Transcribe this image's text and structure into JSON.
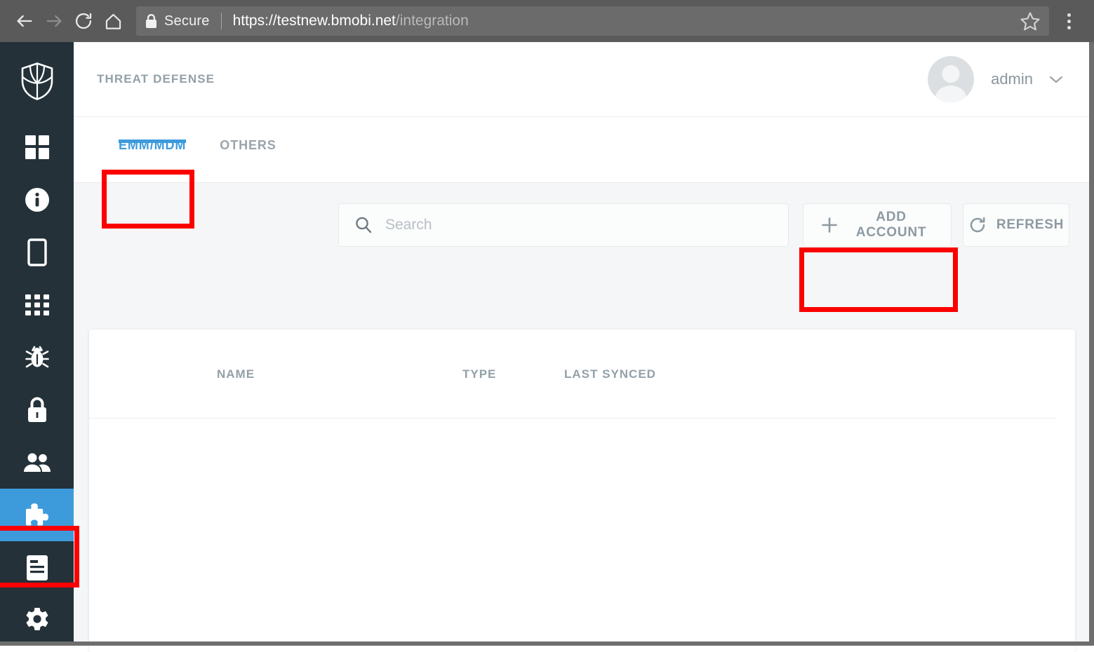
{
  "browser": {
    "back_icon": "back-arrow-icon",
    "forward_icon": "forward-arrow-icon",
    "reload_icon": "reload-icon",
    "home_icon": "home-icon",
    "lock_icon": "lock-icon",
    "security_label": "Secure",
    "url_scheme_host": "https://testnew.bmobi.net",
    "url_path": "/integration",
    "bookmark_icon": "star-icon",
    "menu_icon": "kebab-menu-icon"
  },
  "sidebar": {
    "logo_icon": "shield-logo-icon",
    "items": [
      {
        "icon": "dashboard-grid-icon",
        "name": "dashboard",
        "active": false
      },
      {
        "icon": "info-circle-icon",
        "name": "info",
        "active": false
      },
      {
        "icon": "device-phone-icon",
        "name": "devices",
        "active": false
      },
      {
        "icon": "apps-grid-icon",
        "name": "apps",
        "active": false
      },
      {
        "icon": "bug-icon",
        "name": "threats",
        "active": false
      },
      {
        "icon": "lock-icon",
        "name": "policies",
        "active": false
      },
      {
        "icon": "users-icon",
        "name": "users",
        "active": false
      },
      {
        "icon": "puzzle-piece-icon",
        "name": "integration",
        "active": true
      },
      {
        "icon": "document-icon",
        "name": "reports",
        "active": false
      },
      {
        "icon": "gear-icon",
        "name": "settings",
        "active": false
      }
    ]
  },
  "header": {
    "title": "THREAT DEFENSE",
    "avatar_icon": "user-avatar-icon",
    "username": "admin",
    "caret_icon": "chevron-down-icon"
  },
  "tabs": [
    {
      "label": "EMM/MDM",
      "active": true
    },
    {
      "label": "OTHERS",
      "active": false
    }
  ],
  "toolbar": {
    "search_placeholder": "Search",
    "search_value": "",
    "search_icon": "search-icon",
    "add_account_label": "ADD ACCOUNT",
    "add_account_icon": "plus-icon",
    "refresh_label": "REFRESH",
    "refresh_icon": "refresh-icon"
  },
  "table": {
    "columns": [
      "NAME",
      "TYPE",
      "LAST SYNCED"
    ],
    "rows": []
  },
  "colors": {
    "accent_blue": "#3d9bdc",
    "sidebar_dark": "#243139",
    "annotation_red": "#fc0000",
    "muted_text": "#93a0a8",
    "page_bg": "#f5f6f7"
  }
}
